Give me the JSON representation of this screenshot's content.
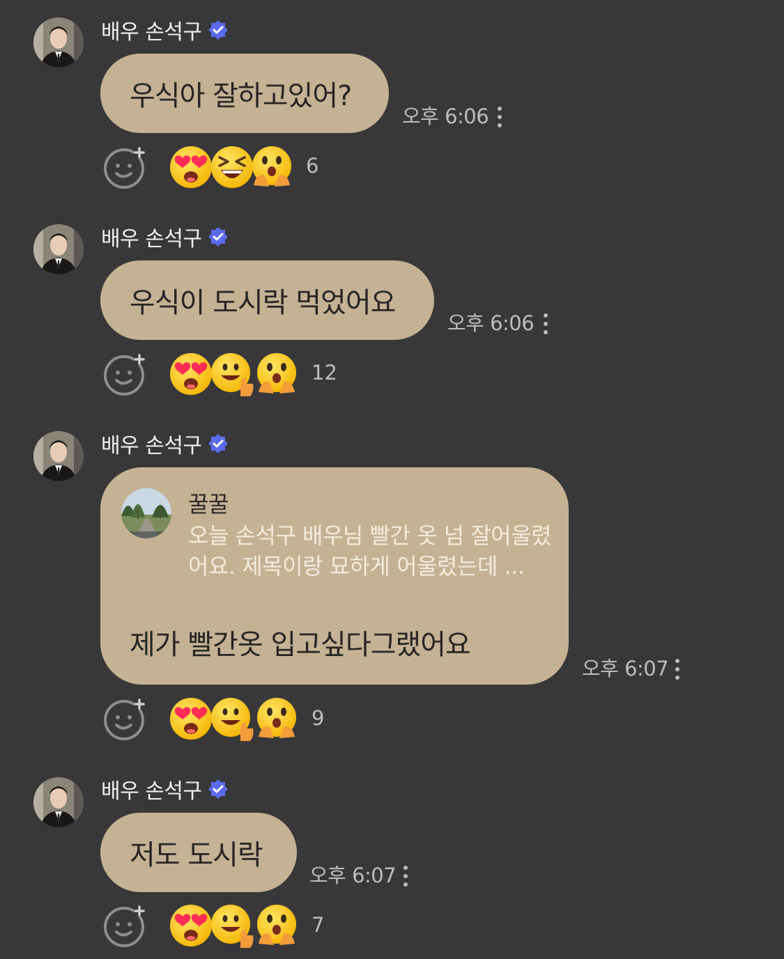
{
  "colors": {
    "background": "#38383a",
    "bubble": "#c4b293",
    "verified": "#5b6bef",
    "muted_text": "#bdbdbd"
  },
  "messages": [
    {
      "sender": "배우 손석구",
      "text": "우식아 잘하고있어?",
      "time": "오후 6:06",
      "reactions": [
        "heart-eyes-emoji",
        "laughing-squint-emoji",
        "excited-hands-emoji"
      ],
      "reaction_count": "6"
    },
    {
      "sender": "배우 손석구",
      "text": "우식이 도시락 먹었어요",
      "time": "오후 6:06",
      "reactions": [
        "heart-eyes-emoji",
        "thumbs-up-smile-emoji",
        "excited-hands-emoji"
      ],
      "reaction_count": "12"
    },
    {
      "sender": "배우 손석구",
      "reply": {
        "name": "꿀꿀",
        "text": "오늘 손석구 배우님 빨간 옷 넘 잘어울렸어요. 제목이랑 묘하게 어울렸는데 ..."
      },
      "text": "제가 빨간옷 입고싶다그랬어요",
      "time": "오후 6:07",
      "reactions": [
        "heart-eyes-emoji",
        "thumbs-up-smile-emoji",
        "excited-hands-emoji"
      ],
      "reaction_count": "9"
    },
    {
      "sender": "배우 손석구",
      "text": "저도 도시락",
      "time": "오후 6:07",
      "reactions": [
        "heart-eyes-emoji",
        "thumbs-up-smile-emoji",
        "excited-hands-emoji"
      ],
      "reaction_count": "7"
    }
  ]
}
